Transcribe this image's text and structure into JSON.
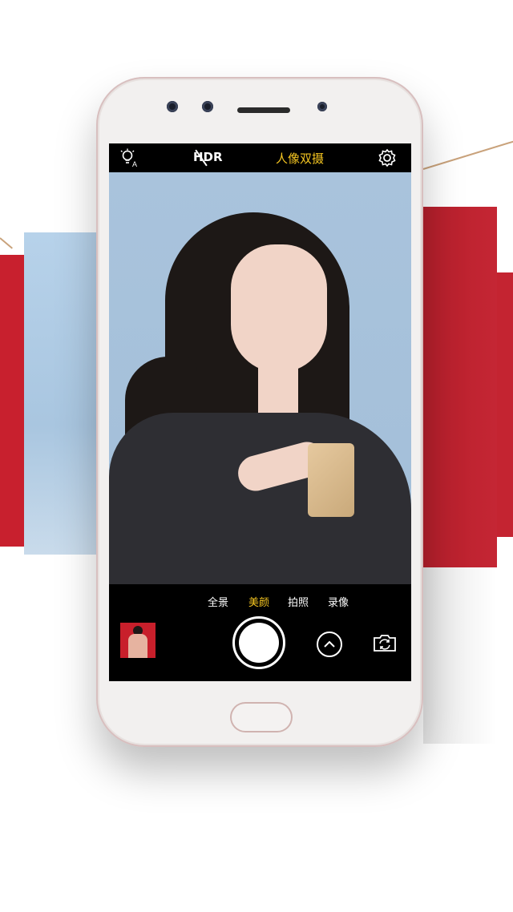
{
  "camera": {
    "mode_title": "人像双摄",
    "hdr_label": "HDR",
    "modes": [
      {
        "label": "全景",
        "active": false
      },
      {
        "label": "美颜",
        "active": true
      },
      {
        "label": "拍照",
        "active": false
      },
      {
        "label": "录像",
        "active": false
      }
    ],
    "icons": {
      "flash": "auto-flash-icon",
      "settings": "gear-icon",
      "expand": "chevron-up-icon",
      "switch": "switch-camera-icon"
    },
    "colors": {
      "accent": "#f3c421",
      "background": "#a9c3dc"
    }
  }
}
